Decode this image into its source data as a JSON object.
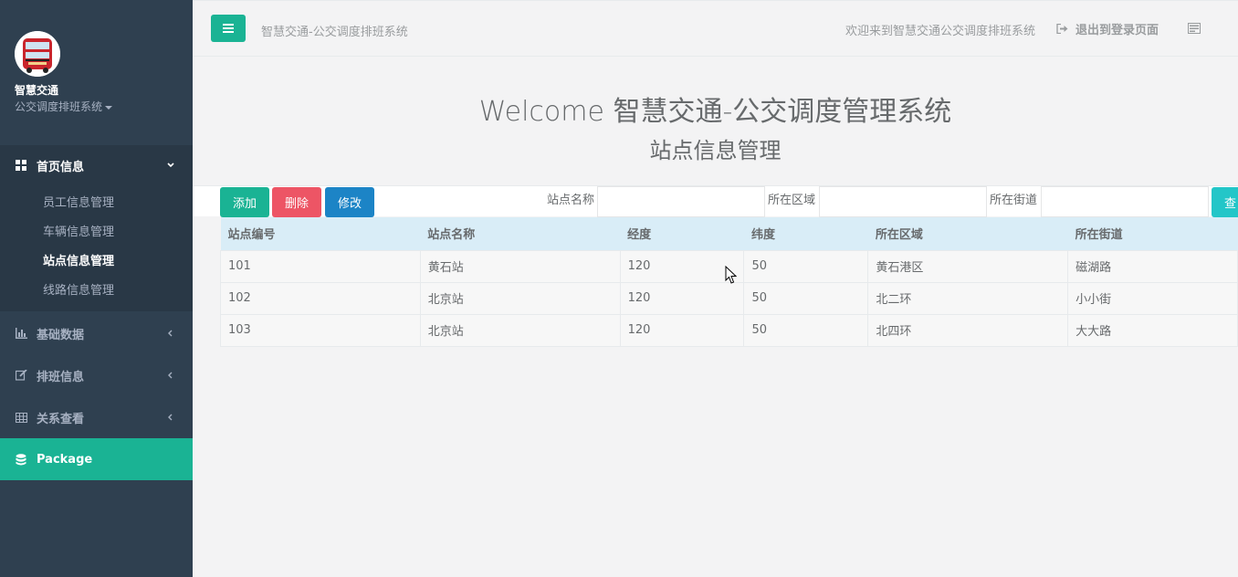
{
  "sidebar": {
    "brand_name": "智慧交通",
    "brand_sub": "公交调度排班系统",
    "home": {
      "label": "首页信息",
      "items": [
        {
          "label": "员工信息管理"
        },
        {
          "label": "车辆信息管理"
        },
        {
          "label": "站点信息管理"
        },
        {
          "label": "线路信息管理"
        }
      ]
    },
    "nav": [
      {
        "label": "基础数据",
        "icon": "bar-chart-icon"
      },
      {
        "label": "排班信息",
        "icon": "edit-icon"
      },
      {
        "label": "关系查看",
        "icon": "table-icon"
      },
      {
        "label": "Package",
        "icon": "database-icon"
      }
    ]
  },
  "topbar": {
    "title": "智慧交通-公交调度排班系统",
    "welcome": "欢迎来到智慧交通公交调度排班系统",
    "logout": "退出到登录页面"
  },
  "heading": {
    "main": "Welcome 智慧交通-公交调度管理系统",
    "sub": "站点信息管理"
  },
  "toolbar": {
    "add": "添加",
    "delete": "删除",
    "edit": "修改",
    "search": "查",
    "filters": [
      {
        "label": "站点名称",
        "value": ""
      },
      {
        "label": "所在区域",
        "value": ""
      },
      {
        "label": "所在街道",
        "value": ""
      }
    ]
  },
  "table": {
    "columns": [
      "站点编号",
      "站点名称",
      "经度",
      "纬度",
      "所在区域",
      "所在街道"
    ],
    "rows": [
      [
        "101",
        "黄石站",
        "120",
        "50",
        "黄石港区",
        "磁湖路"
      ],
      [
        "102",
        "北京站",
        "120",
        "50",
        "北二环",
        "小小街"
      ],
      [
        "103",
        "北京站",
        "120",
        "50",
        "北四环",
        "大大路"
      ]
    ]
  },
  "colors": {
    "sidebar_bg": "#2f4050",
    "accent": "#1ab394",
    "danger": "#ed5565",
    "primary": "#1c84c6",
    "info": "#23c6c8",
    "table_header": "#d9edf7"
  }
}
